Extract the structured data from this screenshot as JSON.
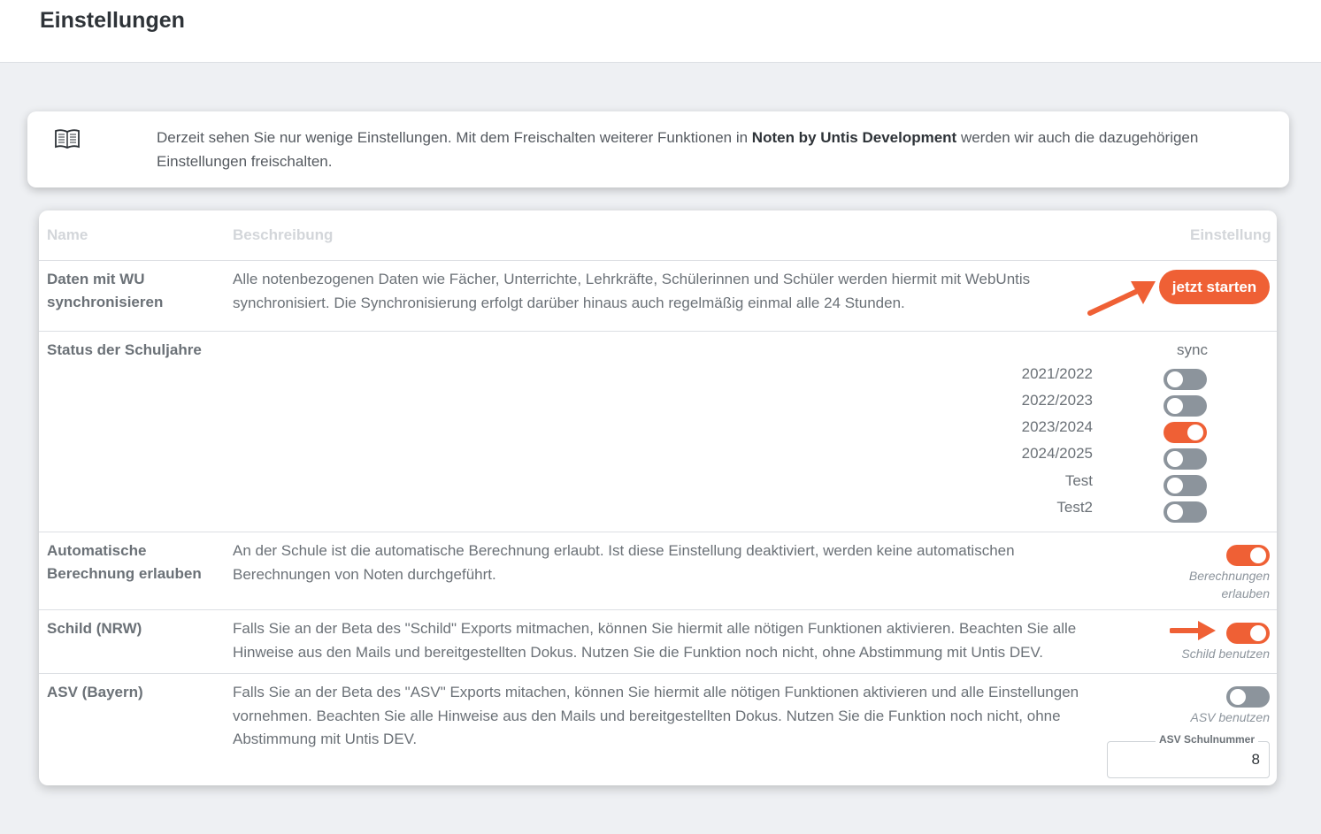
{
  "header": {
    "title": "Einstellungen"
  },
  "info": {
    "icon": "book-icon",
    "text_before": "Derzeit sehen Sie nur wenige Einstellungen. Mit dem Freischalten weiterer Funktionen in ",
    "text_bold": "Noten by Untis Development",
    "text_after": " werden wir auch die dazugehörigen Einstellungen freischalten."
  },
  "table": {
    "columns": {
      "name": "Name",
      "description": "Beschreibung",
      "setting": "Einstellung"
    },
    "sync_row": {
      "name": "Daten mit WU synchronisieren",
      "description": "Alle notenbezogenen Daten wie Fächer, Unterrichte, Lehrkräfte, Schülerinnen und Schüler werden hiermit mit WebUntis synchronisiert. Die Synchronisierung erfolgt darüber hinaus auch regelmäßig einmal alle 24 Stunden.",
      "button_label": "jetzt starten"
    },
    "school_years": {
      "name": "Status der Schuljahre",
      "sync_header": "sync",
      "years": [
        {
          "label": "2021/2022",
          "on": false
        },
        {
          "label": "2022/2023",
          "on": false
        },
        {
          "label": "2023/2024",
          "on": true
        },
        {
          "label": "2024/2025",
          "on": false
        },
        {
          "label": "Test",
          "on": false
        },
        {
          "label": "Test2",
          "on": false
        }
      ]
    },
    "auto_calc": {
      "name": "Automatische Berechnung erlauben",
      "description": "An der Schule ist die automatische Berechnung erlaubt. Ist diese Einstellung deaktiviert, werden keine automatischen Berechnungen von Noten durchgeführt.",
      "toggle_label": "Berechnungen erlauben",
      "on": true
    },
    "schild": {
      "name": "Schild (NRW)",
      "description": "Falls Sie an der Beta des \"Schild\" Exports mitmachen, können Sie hiermit alle nötigen Funktionen aktivieren. Beachten Sie alle Hinweise aus den Mails und bereitgestellten Dokus. Nutzen Sie die Funktion noch nicht, ohne Abstimmung mit Untis DEV.",
      "toggle_label": "Schild benutzen",
      "on": true
    },
    "asv": {
      "name": "ASV (Bayern)",
      "description": "Falls Sie an der Beta des \"ASV\" Exports mitachen, können Sie hiermit alle nötigen Funktionen aktivieren und alle Einstellungen vornehmen. Beachten Sie alle Hinweise aus den Mails und bereitgestellten Dokus. Nutzen Sie die Funktion noch nicht, ohne Abstimmung mit Untis DEV.",
      "toggle_label": "ASV benutzen",
      "on": false,
      "field_label": "ASV Schulnummer",
      "field_value": "8"
    }
  },
  "colors": {
    "accent": "#ef6035",
    "toggle_off": "#8c949c"
  }
}
